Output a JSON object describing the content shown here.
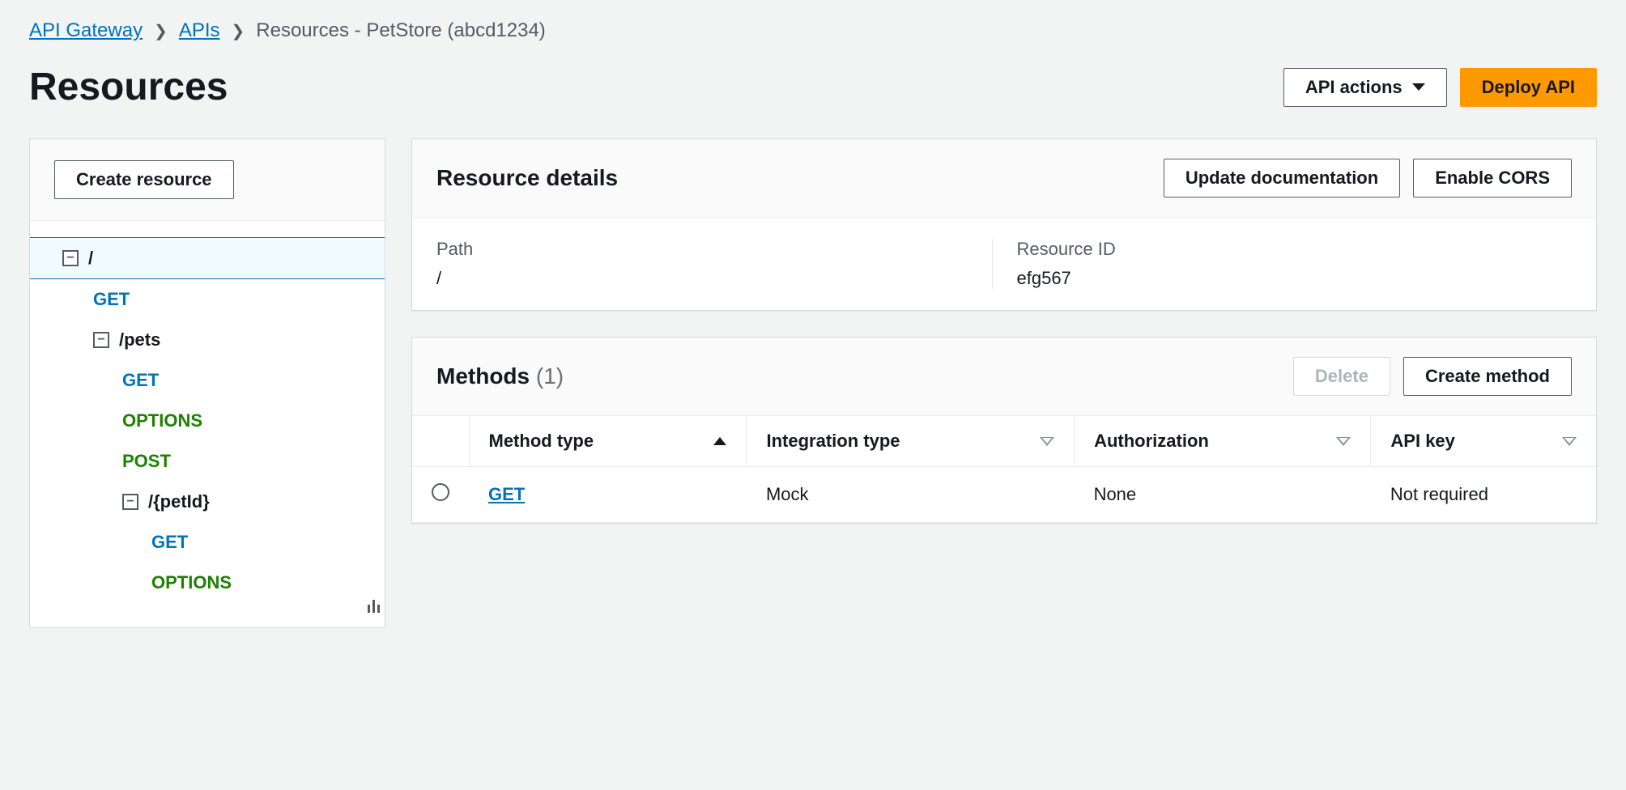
{
  "breadcrumb": {
    "items": [
      {
        "label": "API Gateway",
        "link": true
      },
      {
        "label": "APIs",
        "link": true
      },
      {
        "label": "Resources - PetStore (abcd1234)",
        "link": false
      }
    ]
  },
  "header": {
    "title": "Resources",
    "api_actions_label": "API actions",
    "deploy_label": "Deploy API"
  },
  "sidebar": {
    "create_resource_label": "Create resource",
    "tree": {
      "root": {
        "label": "/"
      },
      "root_get": "GET",
      "pets": {
        "label": "/pets"
      },
      "pets_get": "GET",
      "pets_options": "OPTIONS",
      "pets_post": "POST",
      "petid": {
        "label": "/{petId}"
      },
      "petid_get": "GET",
      "petid_options": "OPTIONS"
    }
  },
  "resource_details": {
    "title": "Resource details",
    "update_doc_label": "Update documentation",
    "enable_cors_label": "Enable CORS",
    "path_label": "Path",
    "path_value": "/",
    "resource_id_label": "Resource ID",
    "resource_id_value": "efg567"
  },
  "methods": {
    "title": "Methods",
    "count": "(1)",
    "delete_label": "Delete",
    "create_label": "Create method",
    "columns": {
      "method_type": "Method type",
      "integration_type": "Integration type",
      "authorization": "Authorization",
      "api_key": "API key"
    },
    "rows": [
      {
        "method": "GET",
        "integration": "Mock",
        "authorization": "None",
        "api_key": "Not required"
      }
    ]
  }
}
